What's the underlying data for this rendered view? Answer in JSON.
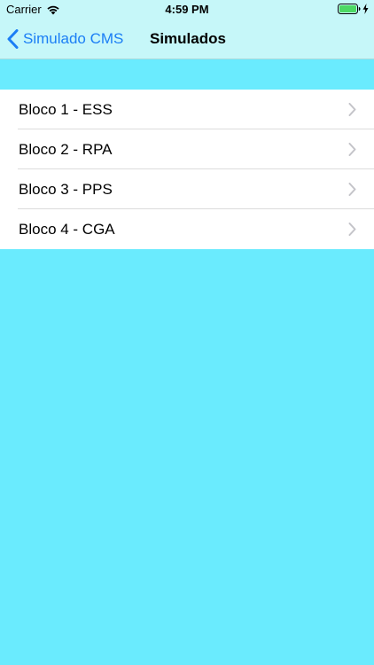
{
  "status_bar": {
    "carrier": "Carrier",
    "time": "4:59 PM",
    "wifi_icon": "wifi-icon",
    "battery_icon": "battery-full-icon",
    "charging_icon": "charging-bolt-icon"
  },
  "nav_bar": {
    "back_label": "Simulado CMS",
    "title": "Simulados",
    "back_icon": "chevron-left-icon"
  },
  "list": {
    "items": [
      {
        "label": "Bloco 1 - ESS"
      },
      {
        "label": "Bloco 2 - RPA"
      },
      {
        "label": "Bloco 3 - PPS"
      },
      {
        "label": "Bloco 4 - CGA"
      }
    ],
    "disclosure_icon": "chevron-right-icon"
  },
  "colors": {
    "background": "#6aebfe",
    "nav_background": "#c6f7f9",
    "accent": "#1b7ef5"
  }
}
